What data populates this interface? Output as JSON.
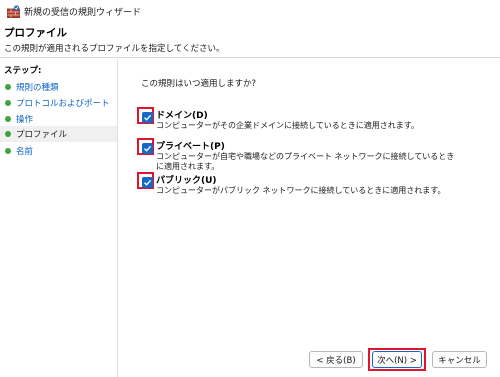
{
  "window": {
    "title": "新規の受信の規則ウィザード"
  },
  "header": {
    "title": "プロファイル",
    "description": "この規則が適用されるプロファイルを指定してください。"
  },
  "sidebar": {
    "heading": "ステップ:",
    "items": [
      {
        "label": "規則の種類"
      },
      {
        "label": "プロトコルおよびポート"
      },
      {
        "label": "操作"
      },
      {
        "label": "プロファイル"
      },
      {
        "label": "名前"
      }
    ]
  },
  "main": {
    "question": "この規則はいつ適用しますか?",
    "options": [
      {
        "label": "ドメイン(D)",
        "description": "コンピューターがその企業ドメインに接続しているときに適用されます。",
        "checked": true
      },
      {
        "label": "プライベート(P)",
        "description": "コンピューターが自宅や職場などのプライベート ネットワークに接続しているときに適用されます。",
        "checked": true
      },
      {
        "label": "パブリック(U)",
        "description": "コンピューターがパブリック ネットワークに接続しているときに適用されます。",
        "checked": true
      }
    ]
  },
  "buttons": {
    "back": "< 戻る(B)",
    "next": "次へ(N) >",
    "cancel": "キャンセル"
  },
  "colors": {
    "accent": "#1568c8",
    "highlight": "#e0142f",
    "step_dot": "#3aa33a",
    "link": "#0b63c6"
  }
}
